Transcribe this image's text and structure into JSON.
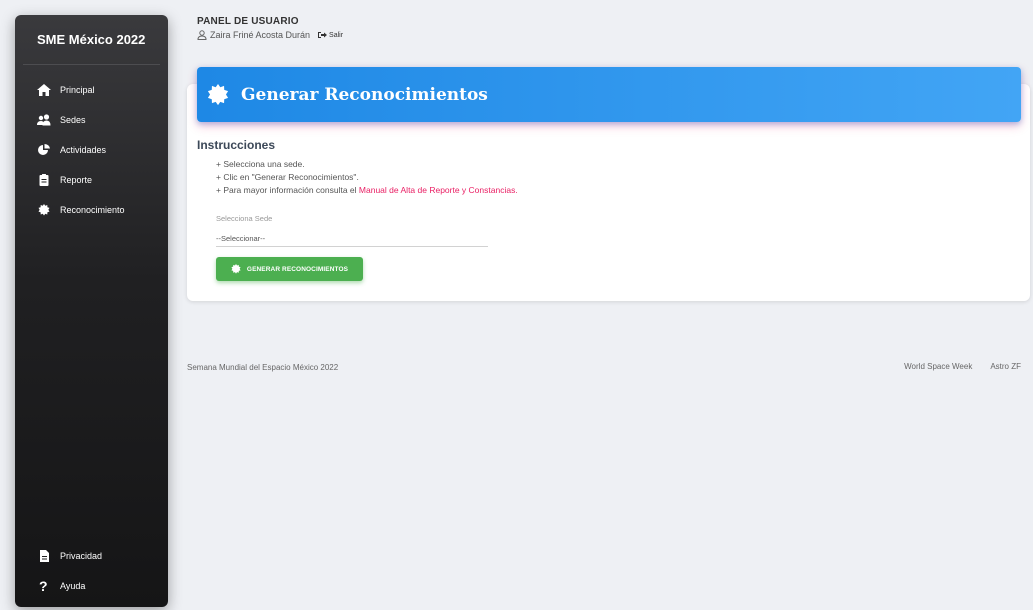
{
  "sidebar": {
    "brand": "SME México 2022",
    "items": [
      {
        "label": "Principal",
        "icon": "home-icon"
      },
      {
        "label": "Sedes",
        "icon": "group-icon"
      },
      {
        "label": "Actividades",
        "icon": "pie-chart-icon"
      },
      {
        "label": "Reporte",
        "icon": "clipboard-icon"
      },
      {
        "label": "Reconocimiento",
        "icon": "certificate-icon"
      }
    ],
    "bottom_items": [
      {
        "label": "Privacidad",
        "icon": "document-icon"
      },
      {
        "label": "Ayuda",
        "icon": "question-icon"
      }
    ]
  },
  "header": {
    "title": "PANEL DE USUARIO",
    "user_name": "Zaira Friné Acosta Durán",
    "logout_label": "Salir"
  },
  "card": {
    "title": "Generar Reconocimientos",
    "header_gradient": [
      "#1e88e5",
      "#42a5f5"
    ]
  },
  "instructions": {
    "title": "Instrucciones",
    "line1": "+ Selecciona una sede.",
    "line2": "+ Clic en \"Generar Reconocimientos\".",
    "line3_prefix": "+ Para mayor información consulta el ",
    "line3_link": "Manual de Alta de Reporte y Constancias."
  },
  "form": {
    "sede_label": "Selecciona Sede",
    "sede_value": "--Seleccionar--",
    "button_label": "GENERAR RECONOCIMIENTOS",
    "button_color": "#4caf50"
  },
  "footer": {
    "left": "Semana Mundial del Espacio México 2022",
    "link1": "World Space Week",
    "link2": "Astro ZF"
  },
  "colors": {
    "accent_link": "#e91e63",
    "background": "#eef0f4"
  }
}
